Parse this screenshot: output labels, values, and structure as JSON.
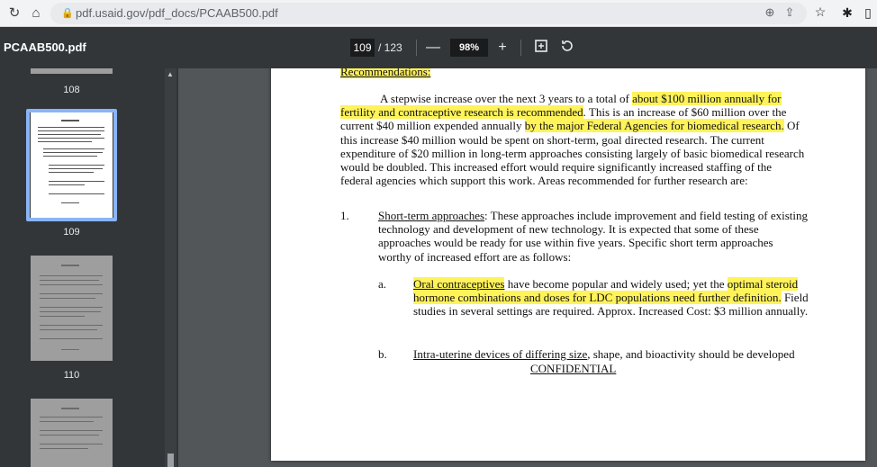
{
  "browser": {
    "url": "pdf.usaid.gov/pdf_docs/PCAAB500.pdf",
    "icons": [
      "reload-icon",
      "home-icon",
      "lock-icon",
      "zoom-icon",
      "share-icon",
      "star-icon",
      "extensions-icon",
      "sidepanel-icon"
    ]
  },
  "toolbar": {
    "file_title": "PCAAB500.pdf",
    "current_page": "109",
    "page_separator": "/ 123",
    "zoom_out": "—",
    "zoom": "98%",
    "zoom_in": "+"
  },
  "sidebar": {
    "labels": {
      "p108": "108",
      "p109": "109",
      "p110": "110"
    }
  },
  "colors": {
    "highlight": "#fff35a",
    "selected_thumb": "#8ab4f8",
    "viewer_bg": "#525659"
  },
  "document": {
    "heading": "Recommendations:",
    "p1": {
      "s1": "A stepwise increase over the next 3 years to a total of ",
      "h1": "about $100 million annually for fertility and contraceptive research is recommended",
      "s2": ". This is an increase of $60 million over the current $40 million expended annually ",
      "h2": "by the major Federal Agencies for biomedical research.",
      "s3": " Of this increase $40 million would be spent on short-term, goal directed research. The current expenditure of $20 million in long-term approaches consisting largely of basic biomedical research would be doubled. This increased effort would require significantly increased staffing of the federal agencies which support this work. Areas recommended for further research are:"
    },
    "item1": {
      "number": "1.",
      "title": "Short-term approaches",
      "text": ": These approaches include improvement and field testing of existing technology and development of new technology. It is expected that some of these approaches would be ready for use within five years. Specific short term approaches worthy of increased effort are as follows:"
    },
    "item_a": {
      "letter": "a.",
      "title": "Oral contraceptives",
      "s1": " have become popular and widely used; yet the ",
      "h1": "optimal steroid hormone combinations and doses for LDC populations need further definition.",
      "s2": " Field studies in several settings are required. Approx. Increased Cost: $3 million annually."
    },
    "item_b": {
      "letter": "b.",
      "title": "Intra-uterine devices of differing size",
      "text": ", shape, and bioactivity should be developed"
    },
    "footer": "CONFIDENTIAL"
  }
}
